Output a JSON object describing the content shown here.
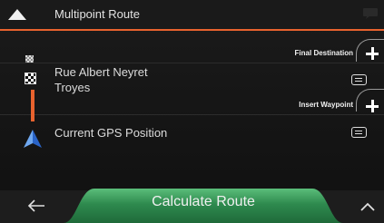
{
  "header": {
    "title": "Multipoint Route",
    "back_icon": "up-triangle-icon",
    "message_icon": "speech-bubble-icon"
  },
  "route": {
    "final_destination_label": "Final Destination",
    "insert_waypoint_label": "Insert Waypoint",
    "destination": {
      "line1": "Rue Albert Neyret",
      "line2": "Troyes",
      "icon": "checkered-flag-icon"
    },
    "start": {
      "label": "Current GPS Position",
      "icon": "gps-arrow-icon"
    }
  },
  "footer": {
    "calculate_label": "Calculate Route",
    "back_icon": "left-arrow-icon",
    "more_icon": "chevron-up-icon"
  },
  "colors": {
    "accent": "#e8622e",
    "button_green": "#2e8a4e",
    "background": "#141414"
  }
}
